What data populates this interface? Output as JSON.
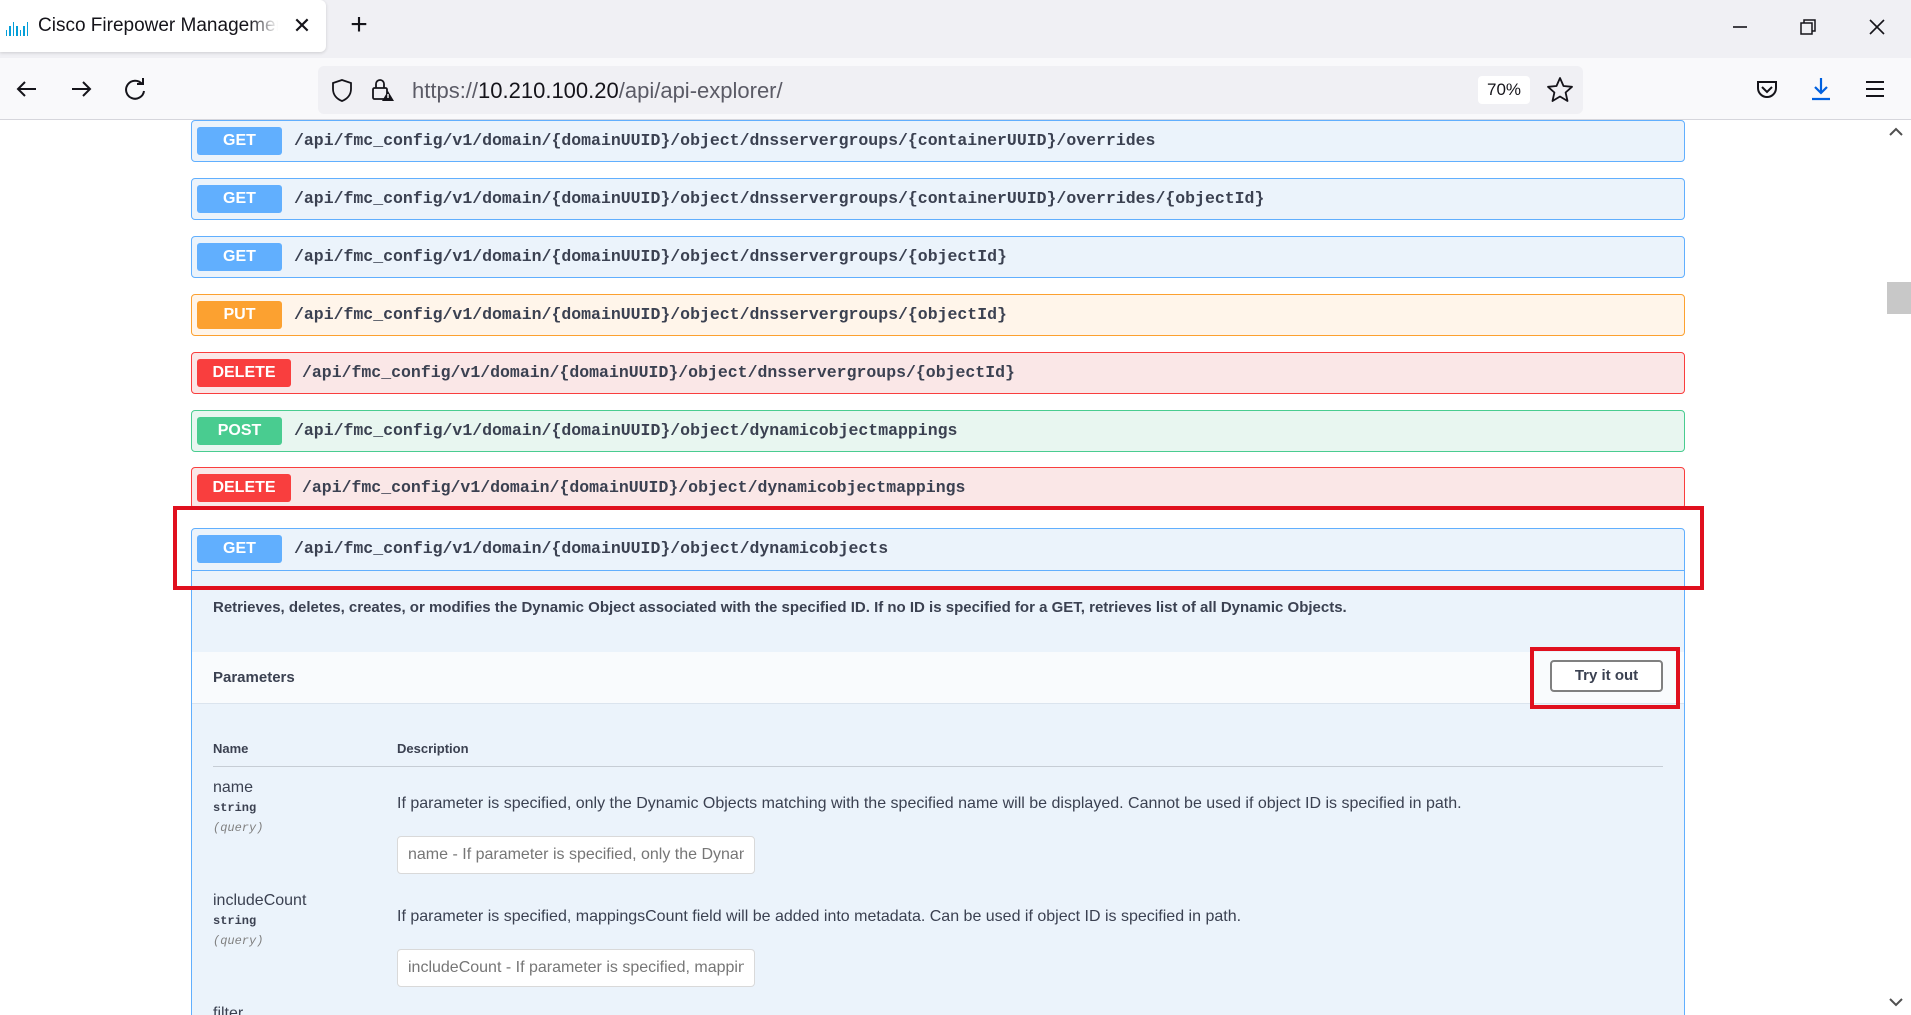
{
  "browser": {
    "tab_title": "Cisco Firepower Management Center",
    "close_glyph": "✕",
    "new_tab_glyph": "+",
    "url_scheme": "https://",
    "url_host": "10.210.100.20",
    "url_path": "/api/api-explorer/",
    "zoom": "70%",
    "icons": [
      "cisco-logo-icon",
      "back-arrow-icon",
      "forward-arrow-icon",
      "reload-icon",
      "shield-icon",
      "lock-warning-icon",
      "bookmark-star-icon",
      "pocket-icon",
      "download-icon",
      "menu-icon",
      "minimize-icon",
      "restore-icon",
      "close-icon"
    ]
  },
  "operations": [
    {
      "method": "GET",
      "path": "/api/fmc_config/v1/domain/{domainUUID}/object/dnsservergroups/{containerUUID}/overrides"
    },
    {
      "method": "GET",
      "path": "/api/fmc_config/v1/domain/{domainUUID}/object/dnsservergroups/{containerUUID}/overrides/{objectId}"
    },
    {
      "method": "GET",
      "path": "/api/fmc_config/v1/domain/{domainUUID}/object/dnsservergroups/{objectId}"
    },
    {
      "method": "PUT",
      "path": "/api/fmc_config/v1/domain/{domainUUID}/object/dnsservergroups/{objectId}"
    },
    {
      "method": "DELETE",
      "path": "/api/fmc_config/v1/domain/{domainUUID}/object/dnsservergroups/{objectId}"
    },
    {
      "method": "POST",
      "path": "/api/fmc_config/v1/domain/{domainUUID}/object/dynamicobjectmappings"
    },
    {
      "method": "DELETE",
      "path": "/api/fmc_config/v1/domain/{domainUUID}/object/dynamicobjectmappings"
    }
  ],
  "expanded_operation": {
    "method": "GET",
    "path": "/api/fmc_config/v1/domain/{domainUUID}/object/dynamicobjects",
    "description": "Retrieves, deletes, creates, or modifies the Dynamic Object associated with the specified ID. If no ID is specified for a GET, retrieves list of all Dynamic Objects.",
    "parameters_title": "Parameters",
    "try_button": "Try it out",
    "col_name": "Name",
    "col_description": "Description",
    "params": [
      {
        "name": "name",
        "type": "string",
        "in": "(query)",
        "description": "If parameter is specified, only the Dynamic Objects matching with the specified name will be displayed. Cannot be used if object ID is specified in path.",
        "placeholder": "name - If parameter is specified, only the Dynamic Objects matching with the specified name will be displayed. Cannot be used if object ID is specified in path."
      },
      {
        "name": "includeCount",
        "type": "string",
        "in": "(query)",
        "description": "If parameter is specified, mappingsCount field will be added into metadata. Can be used if object ID is specified in path.",
        "placeholder": "includeCount - If parameter is specified, mappingsCount field will be added into metadata. Can be used if object ID is specified in path."
      },
      {
        "name": "filter"
      }
    ]
  },
  "colors": {
    "get": "#61affe",
    "put": "#fca130",
    "post": "#49cc90",
    "delete": "#f93e3e",
    "highlight": "#e0101e"
  }
}
